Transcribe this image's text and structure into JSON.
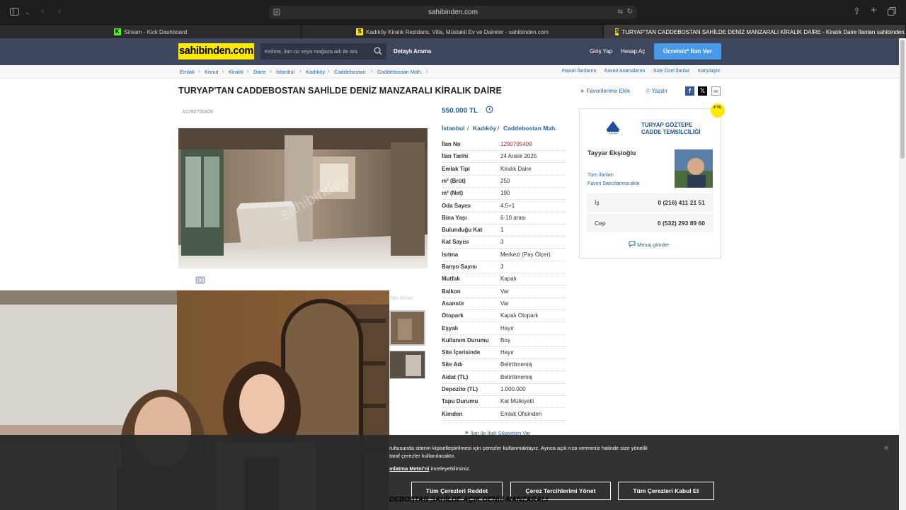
{
  "browser": {
    "url": "sahibinden.com",
    "tabs": [
      {
        "icon": "K",
        "label": "Stream - Kick Dashboard"
      },
      {
        "icon": "S",
        "label": "Kadıköy Kiralık Rezidans, Villa, Müstakil Ev ve Daireler - sahibinden.com"
      },
      {
        "icon": "S",
        "label": "TURYAP'TAN CADDEBOSTAN SAHİLDE DENİZ MANZARALI KİRALIK DAİRE - Kiralık Daire İlanları sahibinden.com'..."
      }
    ]
  },
  "header": {
    "logo": "sahibinden.com",
    "search_placeholder": "Kelime, ilan no veya mağaza adı ile ara",
    "detailed_search": "Detaylı Arama",
    "login": "Giriş Yap",
    "register": "Hesap Aç",
    "post_ad": "Ücretsiz* İlan Ver"
  },
  "breadcrumb": {
    "items": [
      "Emlak",
      "Konut",
      "Kiralık",
      "Daire",
      "İstanbul",
      "Kadıköy",
      "Caddebostan",
      "Caddebostan Mah."
    ],
    "right_links": [
      "Favori İlanlarım",
      "Favori Aramalarım",
      "Size Özel İlanlar",
      "Karşılaştır"
    ]
  },
  "listing": {
    "title": "TURYAP'TAN CADDEBOSTAN SAHİLDE DENİZ MANZARALI KİRALIK DAİRE",
    "add_favorite": "Favorilerime Ekle",
    "print": "Yazdır",
    "listing_no_small": "#1290705409",
    "price": "550.000 TL",
    "location": [
      "İstanbul",
      "Kadıköy",
      "Caddebostan Mah."
    ],
    "properties": [
      {
        "k": "İlan No",
        "v": "1290705409"
      },
      {
        "k": "İlan Tarihi",
        "v": "24 Aralık 2025"
      },
      {
        "k": "Emlak Tipi",
        "v": "Kiralık Daire"
      },
      {
        "k": "m² (Brüt)",
        "v": "250"
      },
      {
        "k": "m² (Net)",
        "v": "190"
      },
      {
        "k": "Oda Sayısı",
        "v": "4.5+1"
      },
      {
        "k": "Bina Yaşı",
        "v": "6-10 arası"
      },
      {
        "k": "Bulunduğu Kat",
        "v": "1"
      },
      {
        "k": "Kat Sayısı",
        "v": "3"
      },
      {
        "k": "Isıtma",
        "v": "Merkezi (Pay Ölçer)"
      },
      {
        "k": "Banyo Sayısı",
        "v": "3"
      },
      {
        "k": "Mutfak",
        "v": "Kapalı"
      },
      {
        "k": "Balkon",
        "v": "Var"
      },
      {
        "k": "Asansör",
        "v": "Var"
      },
      {
        "k": "Otopark",
        "v": "Kapalı Otopark"
      },
      {
        "k": "Eşyalı",
        "v": "Hayır"
      },
      {
        "k": "Kullanım Durumu",
        "v": "Boş"
      },
      {
        "k": "Site İçerisinde",
        "v": "Hayır"
      },
      {
        "k": "Site Adı",
        "v": "Belirtilmemiş"
      },
      {
        "k": "Aidat (TL)",
        "v": "Belirtilmemiş"
      },
      {
        "k": "Depozito (TL)",
        "v": "1.000.000"
      },
      {
        "k": "Tapu Durumu",
        "v": "Kat Mülkiyetli"
      },
      {
        "k": "Kimden",
        "v": "Emlak Ofisinden"
      }
    ],
    "complaint": "İlan ile İlgili Şikayetim Var",
    "photo_watermark": "sahibinden",
    "thumb_label": "Tam Ekran"
  },
  "seller": {
    "store": "TURYAP GÖZTEPE CADDE TEMSİLCİLİĞİ",
    "badge": "8 YIL",
    "agent": "Tayyar Ekşioğlu",
    "all_ads": "Tüm İlanları",
    "add_fav_seller": "Favori Satıcılarıma ekle",
    "phones": [
      {
        "k": "İş",
        "v": "0 (216) 411 21 51"
      },
      {
        "k": "Cep",
        "v": "0 (532) 293 89 60"
      }
    ],
    "message": "Mesaj gönder"
  },
  "cookie": {
    "line1": "rultusunda sitenin kişiselleştirilmesi için çerezler kullanmaktayız. Ayrıca açık rıza vermeniz halinde size yönelik",
    "line2": "taraf çerezler kullanılacaktır.",
    "line3_link": "ınlatma Metni'ni",
    "line3_rest": " inceleyebilirsiniz.",
    "reject": "Tüm Çerezleri Reddet",
    "manage": "Çerez Tercihlerimi Yönet",
    "accept": "Tüm Çerezleri Kabul Et",
    "behind_text": "DEBOSTAN SAHİLDE AÇIK DENİZ MANZARALI"
  },
  "colors": {
    "header_bg": "#3f475f",
    "logo_yellow": "#ffe800",
    "link_blue": "#2464a8",
    "cta_blue": "#489ae9",
    "id_red": "#c0262b"
  }
}
